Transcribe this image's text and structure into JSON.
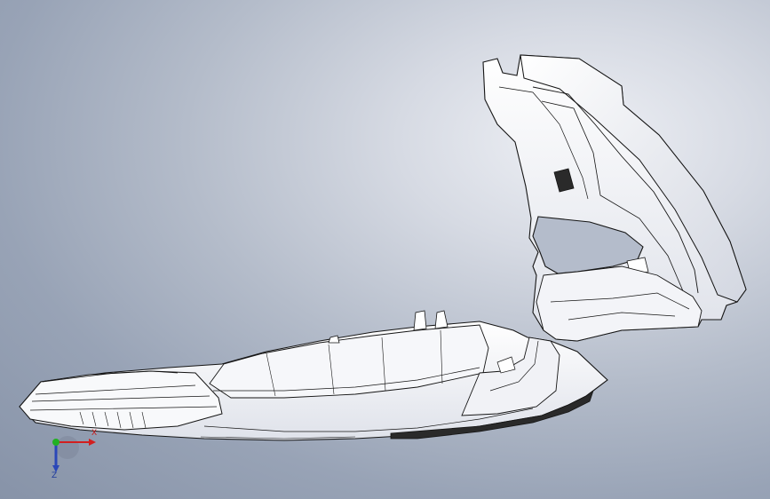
{
  "viewport": {
    "background_center": "#eef0f5",
    "background_edge": "#8793a8"
  },
  "model": {
    "fill": "#ffffff",
    "shade": "#e6e8ef",
    "edge": "#151515",
    "underside": "#2a2a2a"
  },
  "triad": {
    "x_label": "X",
    "z_label": "Z",
    "x_color": "#d21f1f",
    "y_color": "#22b022",
    "z_color": "#2a47b8"
  }
}
